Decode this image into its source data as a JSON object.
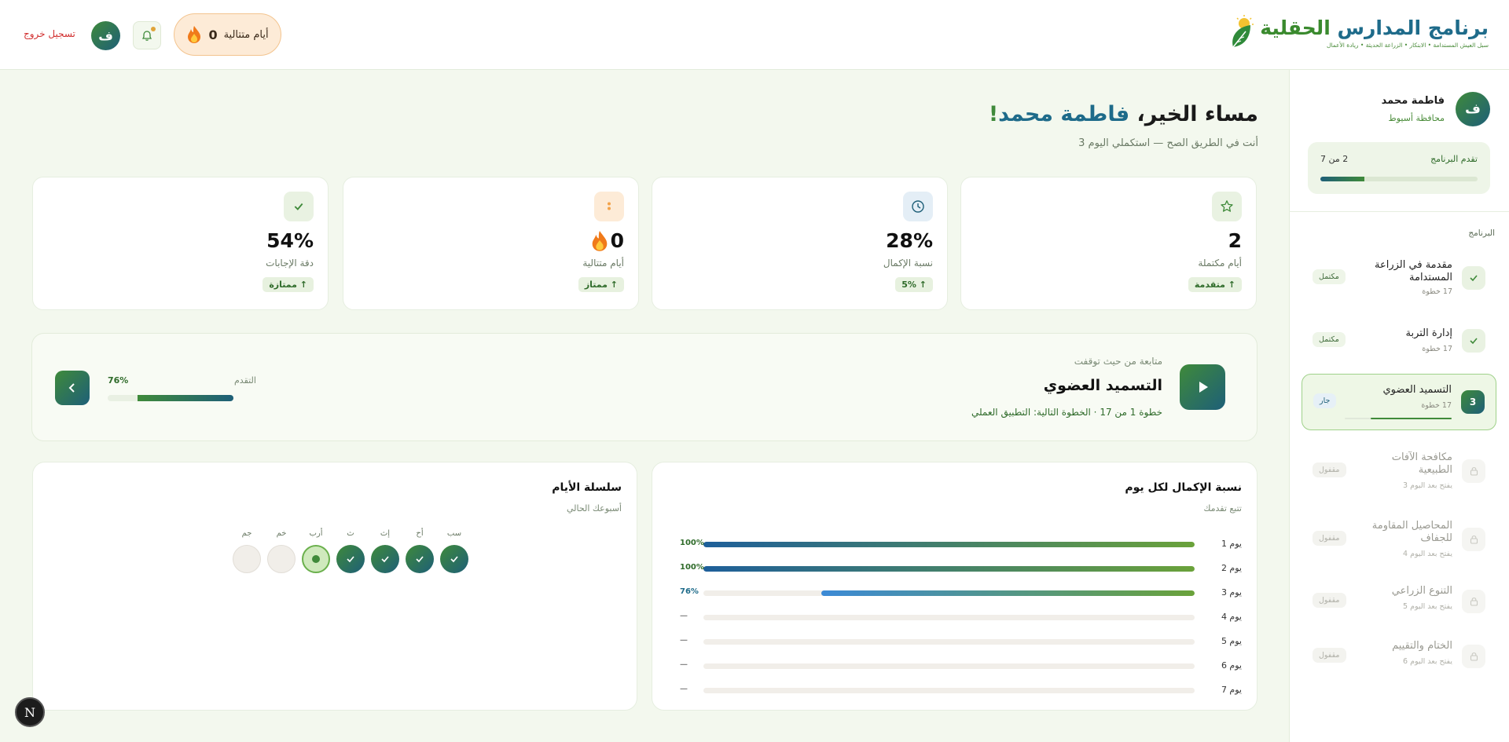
{
  "header": {
    "brand_title_a": "برنامج المدارس",
    "brand_title_b": " الحقلية",
    "brand_tagline": "سبل العيش المستدامة • الابتكار • الزراعة الحديثة • ريادة الأعمال",
    "streak_count": "0",
    "streak_label": "أيام متتالية",
    "avatar_letter": "ف",
    "logout_label": "تسجيل خروج"
  },
  "sidebar": {
    "avatar_letter": "ف",
    "user_name": "فاطمة محمد",
    "governorate": "محافظة أسيوط",
    "progress_label": "تقدم البرنامج",
    "progress_count": "2 من 7",
    "progress_fraction": 0.28,
    "section_label": "البرنامج",
    "modules": [
      {
        "title": "مقدمة في الزراعة المستدامة",
        "sub": "17 خطوة",
        "badge": "مكتمل",
        "state": "done",
        "icon": "check-icon"
      },
      {
        "title": "إدارة التربة",
        "sub": "17 خطوة",
        "badge": "مكتمل",
        "state": "done",
        "icon": "check-icon"
      },
      {
        "title": "التسميد العضوي",
        "sub": "17 خطوة",
        "badge": "جار",
        "state": "current",
        "num": "3",
        "progress_fraction": 0.76
      },
      {
        "title": "مكافحة الآفات الطبيعية",
        "sub": "يفتح بعد اليوم 3",
        "badge": "مقفول",
        "state": "locked",
        "icon": "lock-icon"
      },
      {
        "title": "المحاصيل المقاومة للجفاف",
        "sub": "يفتح بعد اليوم 4",
        "badge": "مقفول",
        "state": "locked",
        "icon": "lock-icon"
      },
      {
        "title": "التنوع الزراعي",
        "sub": "يفتح بعد اليوم 5",
        "badge": "مقفول",
        "state": "locked",
        "icon": "lock-icon"
      },
      {
        "title": "الختام والتقييم",
        "sub": "يفتح بعد اليوم 6",
        "badge": "مقفول",
        "state": "locked",
        "icon": "lock-icon"
      }
    ]
  },
  "main": {
    "greeting_prefix": "مساء الخير، ",
    "greeting_name": "فاطمة محمد",
    "greeting_suffix": "!",
    "greeting_sub": "أنت في الطريق الصح — استكملي اليوم 3",
    "stats": [
      {
        "icon": "star-icon",
        "value": "2",
        "label": "أيام مكتملة",
        "badge": "↑ متقدمة"
      },
      {
        "icon": "clock-icon",
        "value": "28%",
        "label": "نسبة الإكمال",
        "badge": "↑ 5%"
      },
      {
        "icon": "flame-icon",
        "value": "0",
        "label": "أيام متتالية",
        "badge": "↑ ممتاز"
      },
      {
        "icon": "check-icon",
        "value": "54%",
        "label": "دقة الإجابات",
        "badge": "↑ ممتازة"
      }
    ],
    "resume": {
      "caption": "متابعة من حيث توقفت",
      "title": "التسميد العضوي",
      "subtitle": "خطوة 1 من 17 · الخطوة التالية: التطبيق العملي",
      "progress_label": "التقدم",
      "progress_value": "76%",
      "progress_fraction": 0.76
    }
  },
  "completion_card": {
    "title": "نسبة الإكمال لكل يوم",
    "subtitle": "تتبع تقدمك",
    "rows": [
      {
        "label": "يوم 1",
        "value": "100%",
        "fraction": 1.0
      },
      {
        "label": "يوم 2",
        "value": "100%",
        "fraction": 1.0
      },
      {
        "label": "يوم 3",
        "value": "76%",
        "fraction": 0.76
      },
      {
        "label": "يوم 4",
        "value": "—",
        "fraction": 0
      },
      {
        "label": "يوم 5",
        "value": "—",
        "fraction": 0
      },
      {
        "label": "يوم 6",
        "value": "—",
        "fraction": 0
      },
      {
        "label": "يوم 7",
        "value": "—",
        "fraction": 0
      }
    ]
  },
  "streak_card": {
    "title": "سلسلة الأيام",
    "subtitle": "أسبوعك الحالي",
    "days": [
      {
        "label": "سب",
        "state": "done"
      },
      {
        "label": "أح",
        "state": "done"
      },
      {
        "label": "إث",
        "state": "done"
      },
      {
        "label": "ث",
        "state": "done"
      },
      {
        "label": "أرب",
        "state": "today"
      },
      {
        "label": "خم",
        "state": "future"
      },
      {
        "label": "جم",
        "state": "future"
      }
    ]
  },
  "fab_letter": "N",
  "colors": {
    "primary_green": "#3f8a3a",
    "primary_blue": "#1e5f78",
    "accent_red": "#d12e2e",
    "bg": "#f3f8ee"
  }
}
